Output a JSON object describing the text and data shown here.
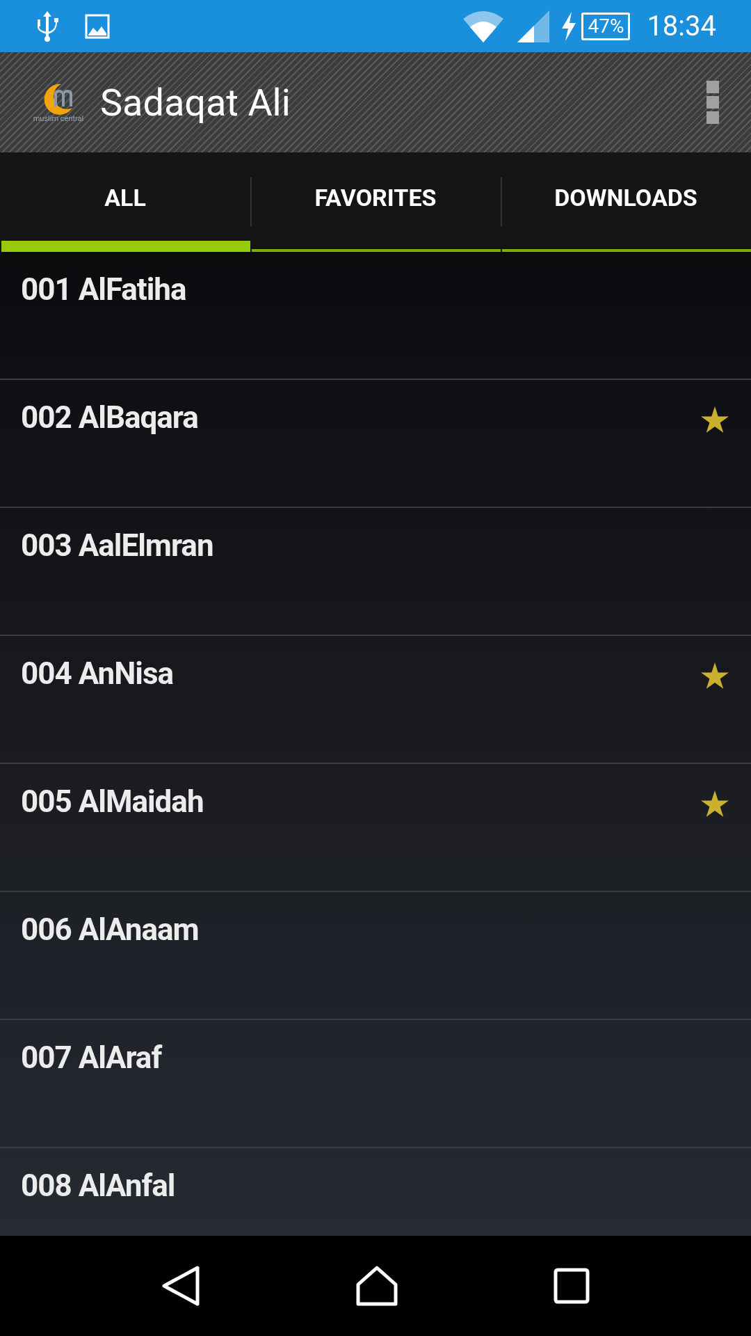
{
  "status_bar": {
    "battery": "47%",
    "time": "18:34"
  },
  "app_bar": {
    "logo_text": "muslim central",
    "title": "Sadaqat Ali"
  },
  "tabs": [
    {
      "label": "ALL",
      "selected": true
    },
    {
      "label": "FAVORITES",
      "selected": false
    },
    {
      "label": "DOWNLOADS",
      "selected": false
    }
  ],
  "rows": [
    {
      "title": "001 AlFatiha",
      "favorite": false
    },
    {
      "title": "002 AlBaqara",
      "favorite": true
    },
    {
      "title": "003 AalElmran",
      "favorite": false
    },
    {
      "title": "004 AnNisa",
      "favorite": true
    },
    {
      "title": "005 AlMaidah",
      "favorite": true
    },
    {
      "title": "006 AlAnaam",
      "favorite": false
    },
    {
      "title": "007 AlAraf",
      "favorite": false
    },
    {
      "title": "008 AlAnfal",
      "favorite": false
    }
  ]
}
